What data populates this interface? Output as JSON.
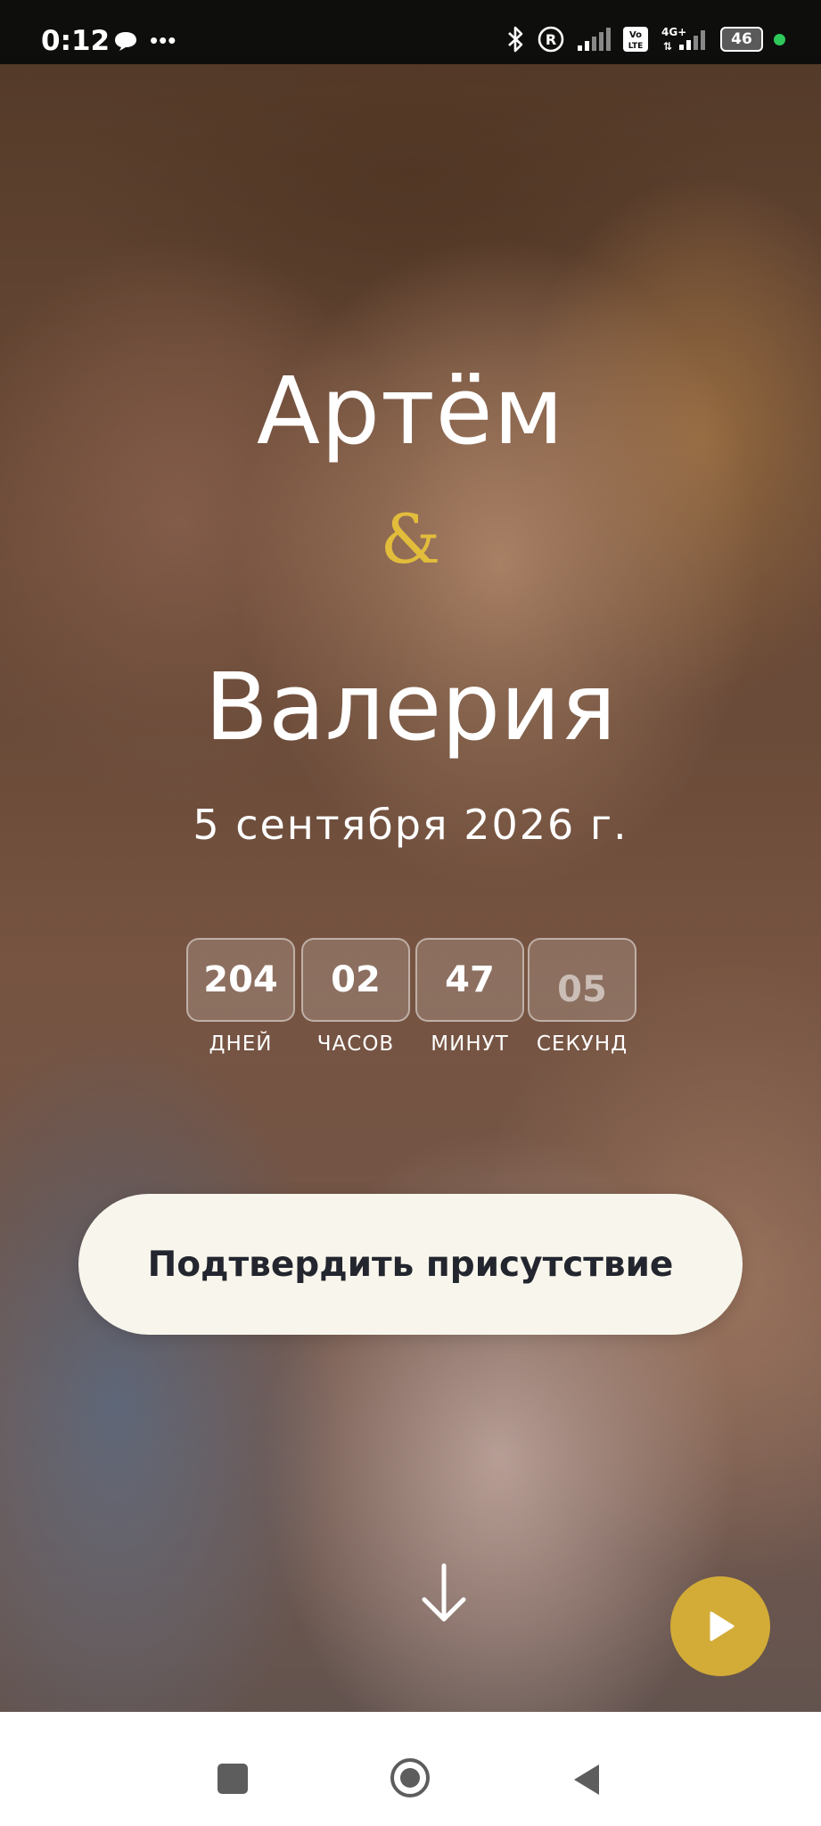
{
  "status_bar": {
    "time": "0:12",
    "battery": "46",
    "icons": [
      "chat-bubble-icon",
      "more-icon",
      "bluetooth-icon",
      "registered-icon",
      "signal-icon",
      "volte-icon",
      "4g-icon",
      "battery-icon",
      "green-dot"
    ]
  },
  "hero": {
    "name_groom": "Артём",
    "ampersand": "&",
    "name_bride": "Валерия",
    "date": "5 сентября 2026 г.",
    "accent_color": "#e2bd3c"
  },
  "countdown": {
    "days": {
      "value": "204",
      "label": "ДНЕЙ"
    },
    "hours": {
      "value": "02",
      "label": "ЧАСОВ"
    },
    "minutes": {
      "value": "47",
      "label": "МИНУТ"
    },
    "seconds": {
      "value": "05",
      "label": "СЕКУНД"
    }
  },
  "rsvp": {
    "label": "Подтвердить присутствие"
  },
  "controls": {
    "scroll_icon": "arrow-down-icon",
    "play_icon": "play-icon",
    "play_color": "#d3ac37"
  },
  "navbar": {
    "icons": [
      "recents-square-icon",
      "home-circle-icon",
      "back-triangle-icon"
    ]
  }
}
